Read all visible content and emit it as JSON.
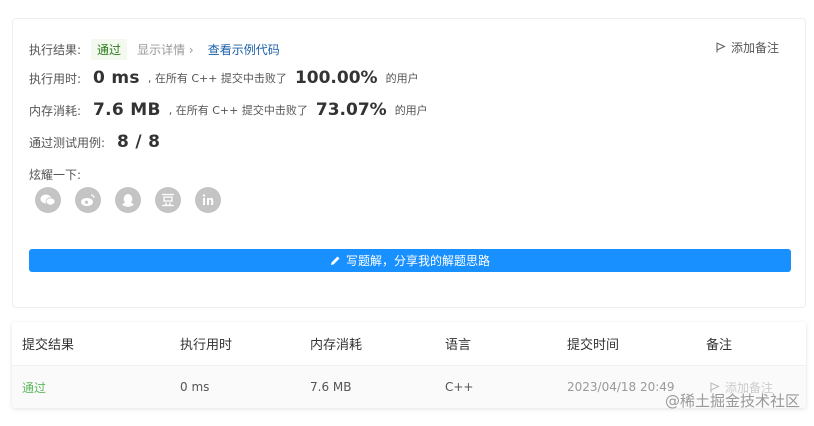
{
  "result": {
    "label": "执行结果:",
    "status": "通过",
    "detail": "显示详情 ›",
    "example": "查看示例代码",
    "add_note": "添加备注"
  },
  "runtime": {
    "label": "执行用时:",
    "value": "0 ms",
    "middle": ", 在所有 C++ 提交中击败了",
    "percent": "100.00%",
    "suffix": "的用户"
  },
  "memory": {
    "label": "内存消耗:",
    "value": "7.6 MB",
    "middle": ", 在所有 C++ 提交中击败了",
    "percent": "73.07%",
    "suffix": "的用户"
  },
  "tests": {
    "label": "通过测试用例:",
    "value": "8 / 8"
  },
  "share": {
    "label": "炫耀一下:",
    "icons": [
      "wechat-icon",
      "weibo-icon",
      "qq-icon",
      "douban-icon",
      "linkedin-icon"
    ]
  },
  "write_solution": "写题解，分享我的解题思路",
  "table": {
    "headers": [
      "提交结果",
      "执行用时",
      "内存消耗",
      "语言",
      "提交时间",
      "备注"
    ],
    "row": {
      "result": "通过",
      "runtime": "0 ms",
      "memory": "7.6 MB",
      "language": "C++",
      "time": "2023/04/18 20:49",
      "note": "添加备注"
    }
  },
  "watermark": "@稀土掘金技术社区",
  "colors": {
    "accent": "#1890ff",
    "pass_green": "#5cb85c",
    "link_blue": "#1a5fa8"
  }
}
